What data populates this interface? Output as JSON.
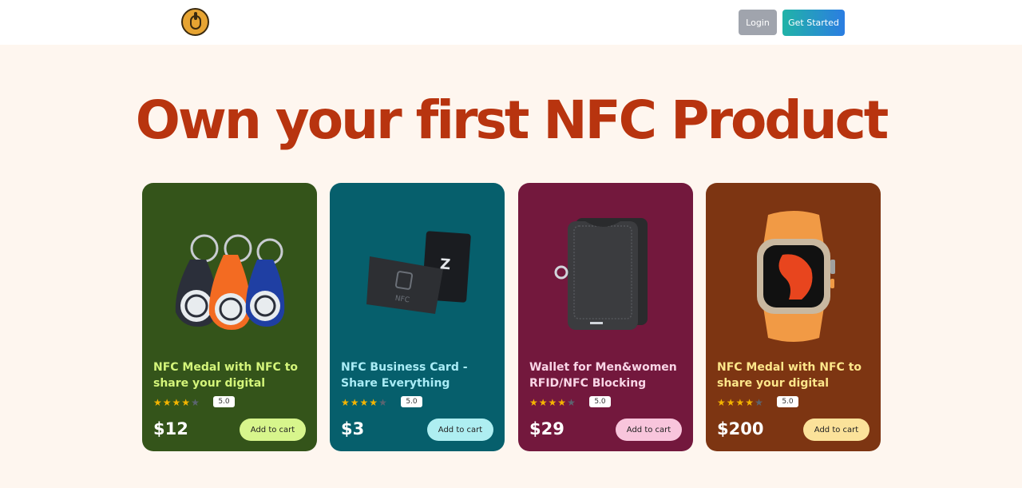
{
  "header": {
    "logo_icon": "coin-logo-icon",
    "login_label": "Login",
    "get_started_label": "Get Started"
  },
  "hero": {
    "title": "Own your first NFC Product"
  },
  "products": [
    {
      "title": "NFC Medal with NFC to share your digital",
      "image_icon": "nfc-keyfob-icon",
      "rating": "5.0",
      "stars_filled": 4,
      "stars_total": 5,
      "price": "$12",
      "cart_label": "Add to cart",
      "bg": "#34541a"
    },
    {
      "title": "NFC Business Card - Share Everything",
      "image_icon": "nfc-card-icon",
      "rating": "5.0",
      "stars_filled": 4,
      "stars_total": 5,
      "price": "$3",
      "cart_label": "Add to cart",
      "bg": "#065f6c"
    },
    {
      "title": "Wallet for Men&women RFID/NFC Blocking",
      "image_icon": "wallet-icon",
      "rating": "5.0",
      "stars_filled": 4,
      "stars_total": 5,
      "price": "$29",
      "cart_label": "Add to cart",
      "bg": "#73183d"
    },
    {
      "title": "NFC Medal with NFC to share your digital",
      "image_icon": "smartwatch-icon",
      "rating": "5.0",
      "stars_filled": 4,
      "stars_total": 5,
      "price": "$200",
      "cart_label": "Add to cart",
      "bg": "#7d3512"
    }
  ]
}
